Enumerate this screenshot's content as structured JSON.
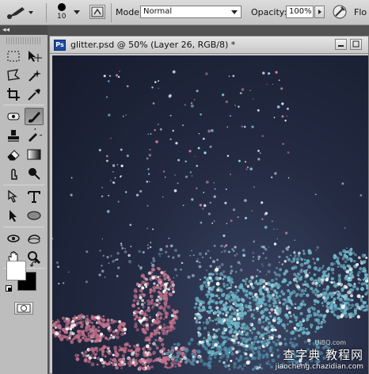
{
  "options_bar": {
    "brush_size": "10",
    "mode_label": "Mode:",
    "mode_value": "Normal",
    "opacity_label": "Opacity:",
    "opacity_value": "100%",
    "flow_label": "Flo"
  },
  "toolbox": {
    "collapse_glyph": "◂◂"
  },
  "document": {
    "app_badge": "Ps",
    "title": "glitter.psd @ 50% (Layer 26, RGB/8) *"
  },
  "watermark": {
    "line1": "查字典 教程网",
    "line2": "jiaocheng.chazidian.com",
    "small": "UiBQ.com"
  },
  "colors": {
    "toolbar_bg": "#c4c4c4",
    "panel_bg": "#535353",
    "canvas_dark": "#1a1f33",
    "glitter_pink": "#c2708a",
    "glitter_teal": "#6fb7c8"
  }
}
